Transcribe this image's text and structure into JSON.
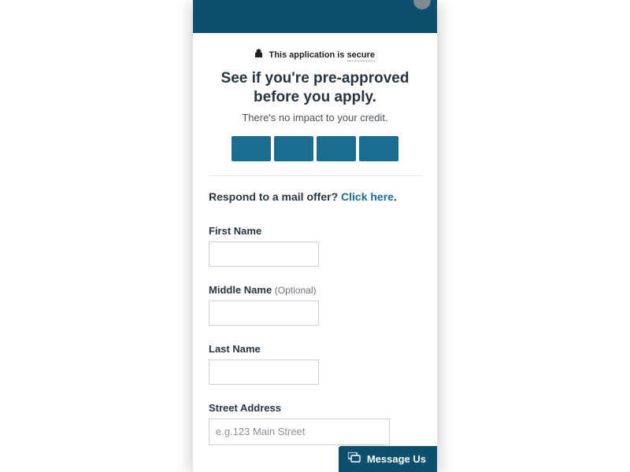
{
  "secure": {
    "prefix": "This application is ",
    "emphasis": "secure"
  },
  "title": "See if you're pre-approved before you apply.",
  "subtitle": "There's no impact to your credit.",
  "mailOffer": {
    "prompt": "Respond to a mail offer? ",
    "linkText": "Click here",
    "suffix": "."
  },
  "fields": {
    "firstName": {
      "label": "First Name",
      "value": ""
    },
    "middleName": {
      "label": "Middle Name ",
      "optional": "(Optional)",
      "value": ""
    },
    "lastName": {
      "label": "Last Name",
      "value": ""
    },
    "streetAddress": {
      "label": "Street Address",
      "placeholder": "e.g.123 Main Street",
      "value": ""
    }
  },
  "messageUs": "Message Us",
  "colors": {
    "brandDark": "#0d4f6c",
    "brandMid": "#1a6d91"
  }
}
